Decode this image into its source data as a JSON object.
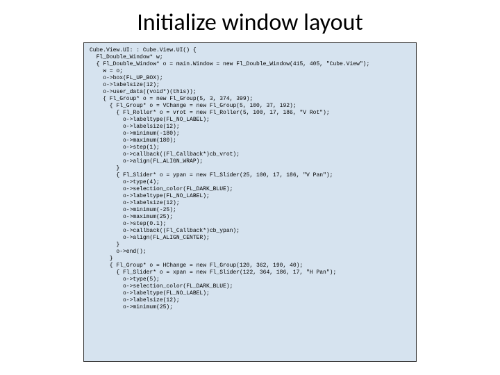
{
  "title": "Initialize window layout",
  "code": "Cube.View.UI: : Cube.View.UI() {\n  Fl_Double_Window* w;\n  { Fl_Double_Window* o = main.Window = new Fl_Double_Window(415, 405, \"Cube.View\");\n    w = o;\n    o->box(FL_UP_BOX);\n    o->labelsize(12);\n    o->user_data((void*)(this));\n    { Fl_Group* o = new Fl_Group(5, 3, 374, 399);\n      { Fl_Group* o = VChange = new Fl_Group(5, 100, 37, 192);\n        { Fl_Roller* o = vrot = new Fl_Roller(5, 100, 17, 186, \"V Rot\");\n          o->labeltype(FL_NO_LABEL);\n          o->labelsize(12);\n          o->minimum(-180);\n          o->maximum(180);\n          o->step(1);\n          o->callback((Fl_Callback*)cb_vrot);\n          o->align(FL_ALIGN_WRAP);\n        }\n        { Fl_Slider* o = ypan = new Fl_Slider(25, 100, 17, 186, \"V Pan\");\n          o->type(4);\n          o->selection_color(FL_DARK_BLUE);\n          o->labeltype(FL_NO_LABEL);\n          o->labelsize(12);\n          o->minimum(-25);\n          o->maximum(25);\n          o->step(0.1);\n          o->callback((Fl_Callback*)cb_ypan);\n          o->align(FL_ALIGN_CENTER);\n        }\n        o->end();\n      }\n      { Fl_Group* o = HChange = new Fl_Group(120, 362, 190, 40);\n        { Fl_Slider* o = xpan = new Fl_Slider(122, 364, 186, 17, \"H Pan\");\n          o->type(5);\n          o->selection_color(FL_DARK_BLUE);\n          o->labeltype(FL_NO_LABEL);\n          o->labelsize(12);\n          o->minimum(25);"
}
